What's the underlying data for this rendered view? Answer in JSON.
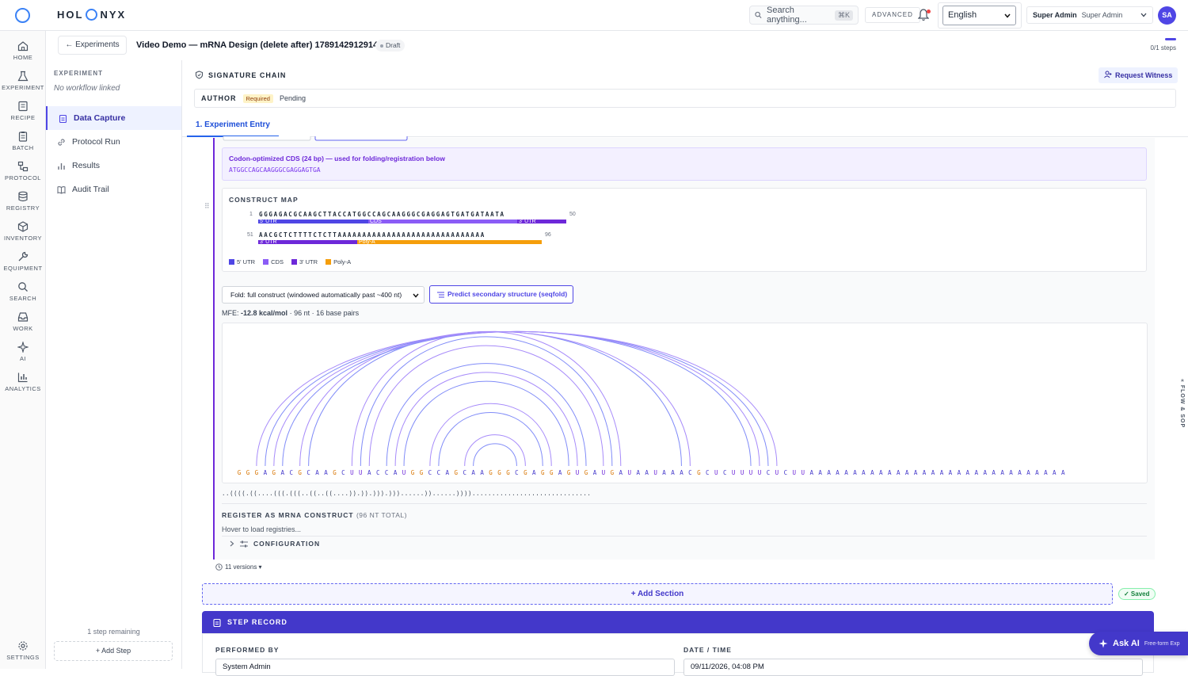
{
  "app": {
    "brand_left": "HOL",
    "brand_right": "NYX"
  },
  "topbar": {
    "search_placeholder": "Search anything...",
    "search_shortcut": "⌘K",
    "advanced": "ADVANCED",
    "language": "English",
    "user_role": "Super Admin",
    "user_name": "Super Admin",
    "avatar": "SA"
  },
  "rail": [
    {
      "label": "HOME",
      "icon": "home-icon"
    },
    {
      "label": "EXPERIMENT",
      "icon": "flask-icon"
    },
    {
      "label": "RECIPE",
      "icon": "recipe-icon"
    },
    {
      "label": "BATCH",
      "icon": "clipboard-icon"
    },
    {
      "label": "PROTOCOL",
      "icon": "workflow-icon"
    },
    {
      "label": "REGISTRY",
      "icon": "database-icon"
    },
    {
      "label": "INVENTORY",
      "icon": "box-icon"
    },
    {
      "label": "EQUIPMENT",
      "icon": "wrench-icon"
    },
    {
      "label": "SEARCH",
      "icon": "search-icon"
    },
    {
      "label": "WORK",
      "icon": "inbox-icon"
    },
    {
      "label": "AI",
      "icon": "sparkles-icon"
    },
    {
      "label": "ANALYTICS",
      "icon": "bar-chart-icon"
    },
    {
      "label": "SETTINGS",
      "icon": "gear-icon"
    }
  ],
  "sidebar": {
    "heading": "EXPERIMENT",
    "subheading": "No workflow linked",
    "items": [
      {
        "label": "Data Capture"
      },
      {
        "label": "Protocol Run"
      },
      {
        "label": "Results"
      },
      {
        "label": "Audit Trail"
      }
    ],
    "remaining": "1 step remaining",
    "add_step": "+ Add Step"
  },
  "header": {
    "back": "← Experiments",
    "title": "Video Demo — mRNA Design (delete after) 1789142912914",
    "status": "Draft",
    "steps": "0/1 steps"
  },
  "signature": {
    "heading": "SIGNATURE CHAIN",
    "request_witness": "Request Witness",
    "author_label": "AUTHOR",
    "required": "Required",
    "pending": "Pending"
  },
  "tabs": [
    {
      "label": "1. Experiment Entry"
    }
  ],
  "codon": {
    "title": "Codon-optimized CDS (24 bp) — used for folding/registration below",
    "sequence": "ATGGCCAGCAAGGGCGAGGAGTGA"
  },
  "construct_map": {
    "title": "CONSTRUCT MAP",
    "row1_start": "1",
    "row1_seq": "GGGAGACGCAAGCTTACCATGGCCAGCAAGGGCGAGGAGTGATGATAATA",
    "row1_end": "50",
    "row2_start": "51",
    "row2_seq": "AACGCTCTTTTCTCTTAAAAAAAAAAAAAAAAAAAAAAAAAAAAAA",
    "row2_end": "96",
    "segments": {
      "utr5": "5' UTR",
      "cds": "CDS",
      "utr3": "3' UTR",
      "polya": "Poly-A"
    },
    "legend": [
      "5' UTR",
      "CDS",
      "3' UTR",
      "Poly-A"
    ],
    "colors": {
      "utr5": "#4f46e5",
      "cds": "#8b5cf6",
      "utr3": "#6d28d9",
      "polya": "#f59e0b"
    }
  },
  "fold": {
    "select": "Fold: full construct (windowed automatically past ~400 nt)",
    "predict": "Predict secondary structure (seqfold)",
    "mfe_label": "MFE:",
    "mfe_value": "-12.8 kcal/mol",
    "mfe_rest": "· 96 nt · 16 base pairs",
    "sequence": "GGGAGACGCAAGCUUACCAUGGCCAGCAAGGGCGAGGAGUGAUGAUAAUAAACGCUCUUUUCUCUUAAAAAAAAAAAAAAAAAAAAAAAAAAAAAA",
    "dot_bracket": "..((((.((....(((.(((..((..((....)).)).))).)))......))......)))).............................."
  },
  "register": {
    "title": "REGISTER AS MRNA CONSTRUCT",
    "meta": "(96 NT TOTAL)",
    "hint": "Hover to load registries...",
    "config": "CONFIGURATION"
  },
  "versions": "11 versions ▾",
  "add_section": "+ Add Section",
  "saved": "✓ Saved",
  "step_record": {
    "title": "STEP RECORD",
    "performed_by_label": "PERFORMED BY",
    "performed_by": "System Admin",
    "datetime_label": "DATE / TIME",
    "datetime": "09/11/2026, 04:08 PM"
  },
  "ask_ai": {
    "label": "Ask AI",
    "sub": "Free-form Exp"
  },
  "flow_tab": "« FLOW & SOP"
}
